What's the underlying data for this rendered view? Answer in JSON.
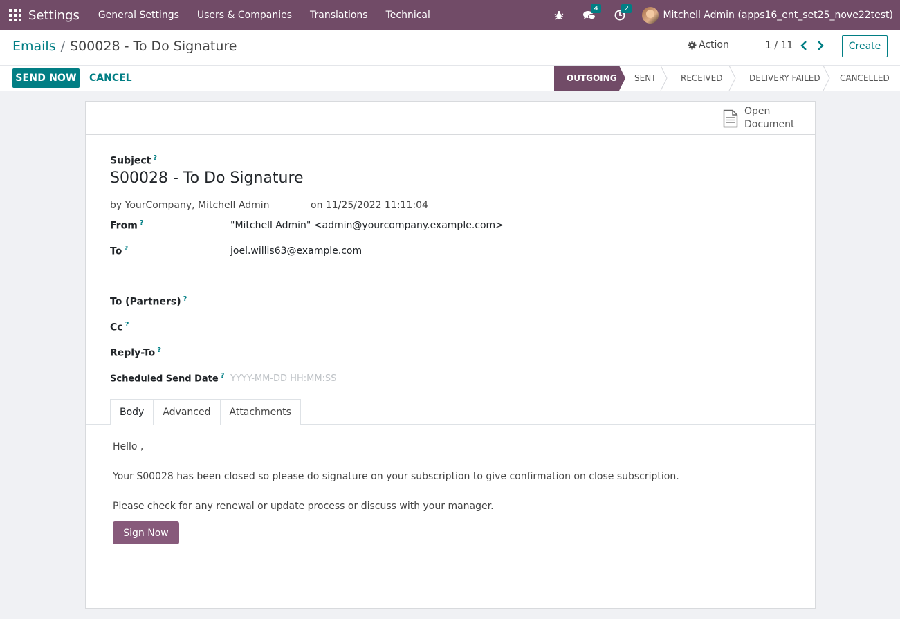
{
  "navbar": {
    "app_name": "Settings",
    "menu": [
      "General Settings",
      "Users & Companies",
      "Translations",
      "Technical"
    ],
    "messages_count": "4",
    "activities_count": "2",
    "user": "Mitchell Admin (apps16_ent_set25_nove22test)",
    "colors": {
      "navbar_bg": "#714b67",
      "badge_bg": "#017e84"
    }
  },
  "breadcrumb": {
    "parent": "Emails",
    "separator": "/",
    "current": "S00028 - To Do Signature"
  },
  "control": {
    "action_label": "Action",
    "pager": "1 / 11",
    "create_label": "Create",
    "send_now_label": "SEND NOW",
    "cancel_label": "CANCEL"
  },
  "statusbar": {
    "steps": [
      "OUTGOING",
      "SENT",
      "RECEIVED",
      "DELIVERY FAILED",
      "CANCELLED"
    ],
    "active": "OUTGOING"
  },
  "form": {
    "open_document_label": "Open Document",
    "subject_label": "Subject",
    "subject": "S00028 - To Do Signature",
    "author": "by YourCompany, Mitchell Admin",
    "date": "on 11/25/2022 11:11:04",
    "help_mark": "?",
    "from_label": "From",
    "from_value": "\"Mitchell Admin\" <admin@yourcompany.example.com>",
    "to_label": "To",
    "to_value": "joel.willis63@example.com",
    "to_partners_label": "To (Partners)",
    "cc_label": "Cc",
    "reply_to_label": "Reply-To",
    "scheduled_label": "Scheduled Send Date",
    "scheduled_placeholder": "YYYY-MM-DD HH:MM:SS"
  },
  "tabs": [
    "Body",
    "Advanced",
    "Attachments"
  ],
  "body": {
    "greeting": "Hello ,",
    "line1": "Your S00028 has been closed so please do signature on your subscription to give confirmation on close subscription.",
    "line2": "Please check for any renewal or update process or discuss with your manager.",
    "sign_button": "Sign Now"
  }
}
